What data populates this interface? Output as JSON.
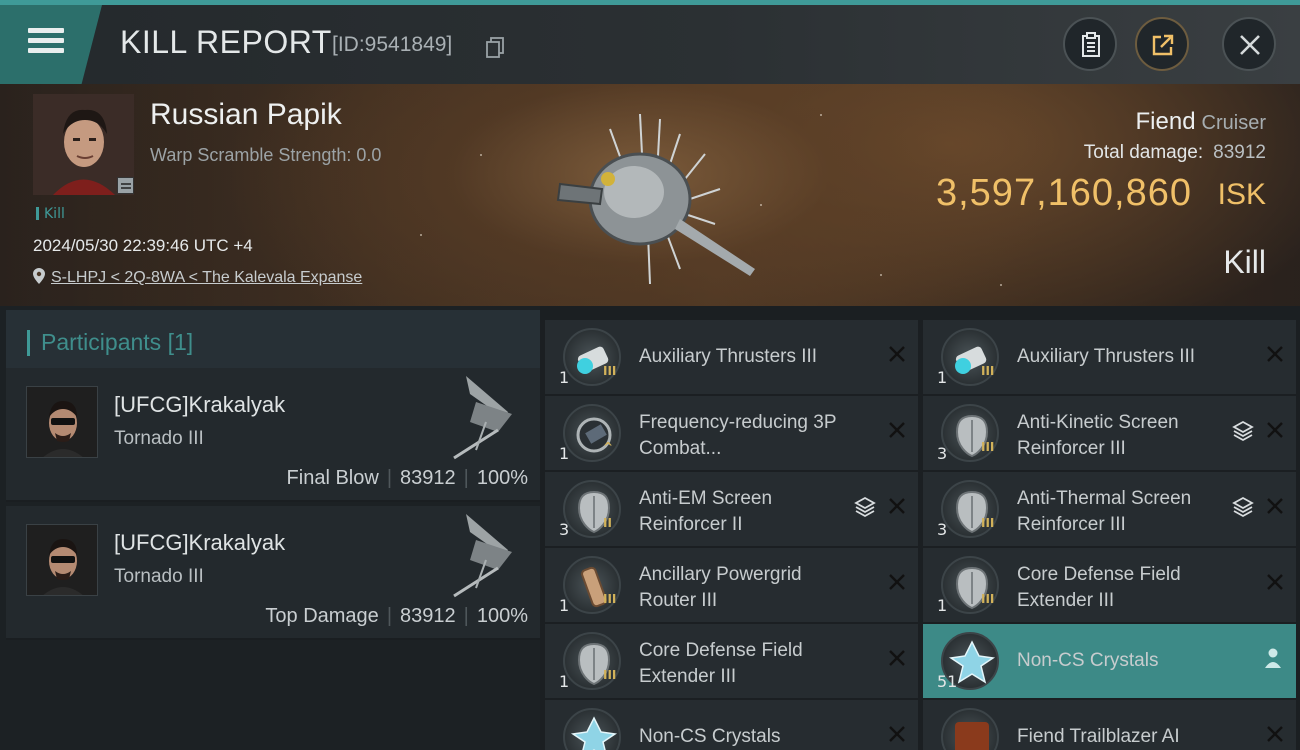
{
  "header": {
    "title": "KILL REPORT",
    "report_id": "[ID:9541849]"
  },
  "victim": {
    "name": "Russian Papik",
    "warp_scramble": "Warp Scramble Strength: 0.0",
    "kill_tag": "Kill",
    "timestamp": "2024/05/30 22:39:46 UTC +4",
    "location": "S-LHPJ < 2Q-8WA < The Kalevala Expanse",
    "ship_name": "Fiend",
    "ship_class": "Cruiser",
    "total_damage_label": "Total damage:",
    "total_damage_value": "83912",
    "isk_value": "3,597,160,860",
    "isk_label": "ISK",
    "result": "Kill"
  },
  "participants": {
    "label": "Participants",
    "count": "[1]",
    "cards": [
      {
        "name": "[UFCG]Krakalyak",
        "ship": "Tornado III",
        "role": "Final Blow",
        "damage": "83912",
        "percent": "100%"
      },
      {
        "name": "[UFCG]Krakalyak",
        "ship": "Tornado III",
        "role": "Top Damage",
        "damage": "83912",
        "percent": "100%"
      }
    ]
  },
  "items": [
    {
      "name": "Auxiliary Thrusters III",
      "qty": "1",
      "meta": "III",
      "icon": "thruster-icon",
      "stack": false
    },
    {
      "name": "Auxiliary Thrusters III",
      "qty": "1",
      "meta": "III",
      "icon": "thruster-icon",
      "stack": false
    },
    {
      "name": "Frequency-reducing 3P Combat...",
      "qty": "1",
      "meta": "^",
      "icon": "scanner-icon",
      "stack": false
    },
    {
      "name": "Anti-Kinetic Screen Reinforcer III",
      "qty": "3",
      "meta": "III",
      "icon": "shield-icon",
      "stack": true
    },
    {
      "name": "Anti-EM Screen Reinforcer II",
      "qty": "3",
      "meta": "II",
      "icon": "shield-icon",
      "stack": true
    },
    {
      "name": "Anti-Thermal Screen Reinforcer III",
      "qty": "3",
      "meta": "III",
      "icon": "shield-icon",
      "stack": true
    },
    {
      "name": "Ancillary Powergrid Router III",
      "qty": "1",
      "meta": "III",
      "icon": "battery-icon",
      "stack": false
    },
    {
      "name": "Core Defense Field Extender III",
      "qty": "1",
      "meta": "III",
      "icon": "shield-icon",
      "stack": false
    },
    {
      "name": "Core Defense Field Extender III",
      "qty": "1",
      "meta": "III",
      "icon": "shield-icon",
      "stack": false
    },
    {
      "name": "Non-CS Crystals",
      "qty": "51",
      "meta": "",
      "icon": "crystal-icon",
      "stack": false,
      "highlight": true
    },
    {
      "name": "Non-CS Crystals",
      "qty": "",
      "meta": "",
      "icon": "crystal-icon",
      "stack": false
    },
    {
      "name": "Fiend Trailblazer AI",
      "qty": "",
      "meta": "",
      "icon": "ai-chip-icon",
      "stack": false
    }
  ]
}
